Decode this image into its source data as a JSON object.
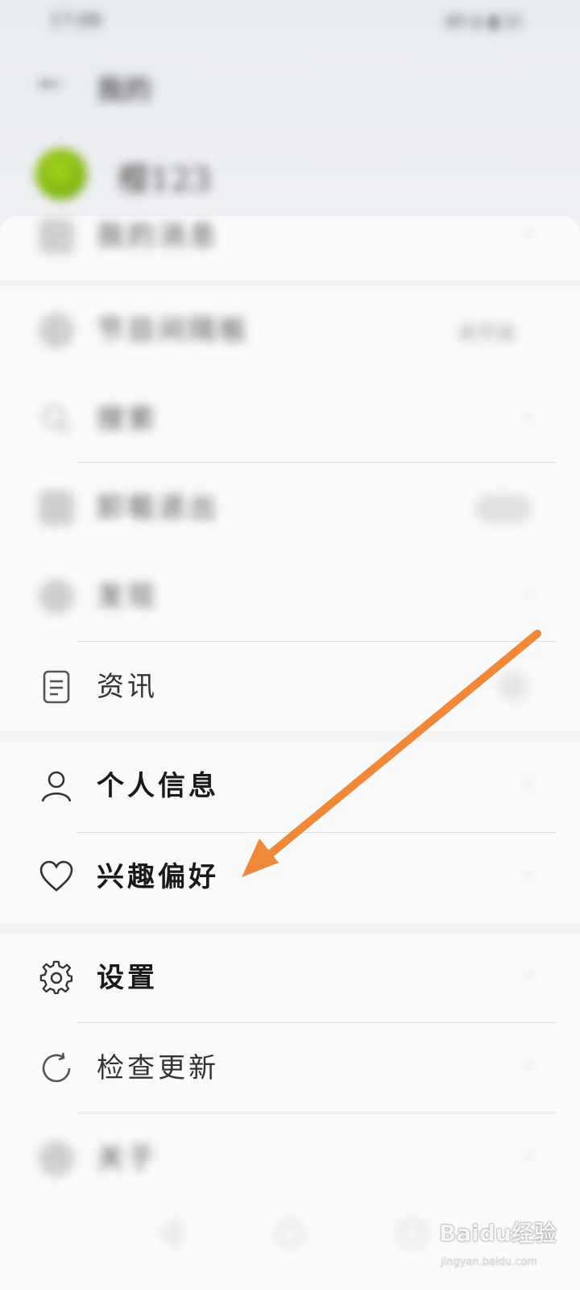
{
  "status_bar": {
    "time": "17:09",
    "right": "49  ◎  ▮ 21"
  },
  "header": {
    "back_icon": "back-arrow-icon",
    "title": "我的"
  },
  "profile": {
    "username": "樱123"
  },
  "menu": {
    "messages": {
      "label": "我的消息"
    },
    "anonymous": {
      "label": "节目间隔板",
      "value": "未开启"
    },
    "search": {
      "label": "搜索"
    },
    "pinned": {
      "label": "卸载退出"
    },
    "discover": {
      "label": "发现"
    },
    "news": {
      "label": "资讯"
    },
    "personal_info": {
      "label": "个人信息"
    },
    "interests": {
      "label": "兴趣偏好"
    },
    "settings": {
      "label": "设置"
    },
    "check_update": {
      "label": "检查更新"
    },
    "about": {
      "label": "关于"
    }
  },
  "annotation": {
    "color": "#f0883a"
  },
  "watermark": {
    "main": "Baidu经验",
    "sub": "jingyan.baidu.com"
  }
}
